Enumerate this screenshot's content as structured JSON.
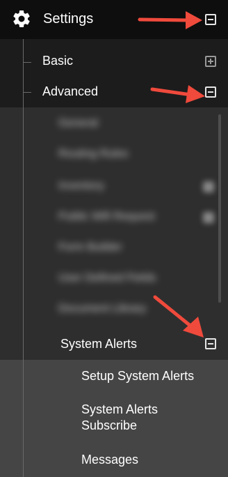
{
  "header": {
    "title": "Settings",
    "icon": "gear-icon",
    "toggle": "minus"
  },
  "menu": {
    "basic": {
      "label": "Basic",
      "toggle": "plus"
    },
    "advanced": {
      "label": "Advanced",
      "toggle": "minus"
    }
  },
  "advanced_items": [
    "General",
    "Routing Rules",
    "Inventory",
    "Public Wifi Request",
    "Form Builder",
    "User Defined Fields",
    "Document Library"
  ],
  "system_alerts": {
    "label": "System Alerts",
    "toggle": "minus",
    "children": {
      "setup": "Setup System Alerts",
      "subscribe_line1": "System Alerts",
      "subscribe_line2": "Subscribe",
      "messages": "Messages"
    }
  },
  "colors": {
    "header_bg": "#0e0e0e",
    "panel_bg": "#1c1c1c",
    "sub_bg": "#2e2e2e",
    "leaf_bg": "#454545",
    "arrow": "#ef4a3c"
  }
}
